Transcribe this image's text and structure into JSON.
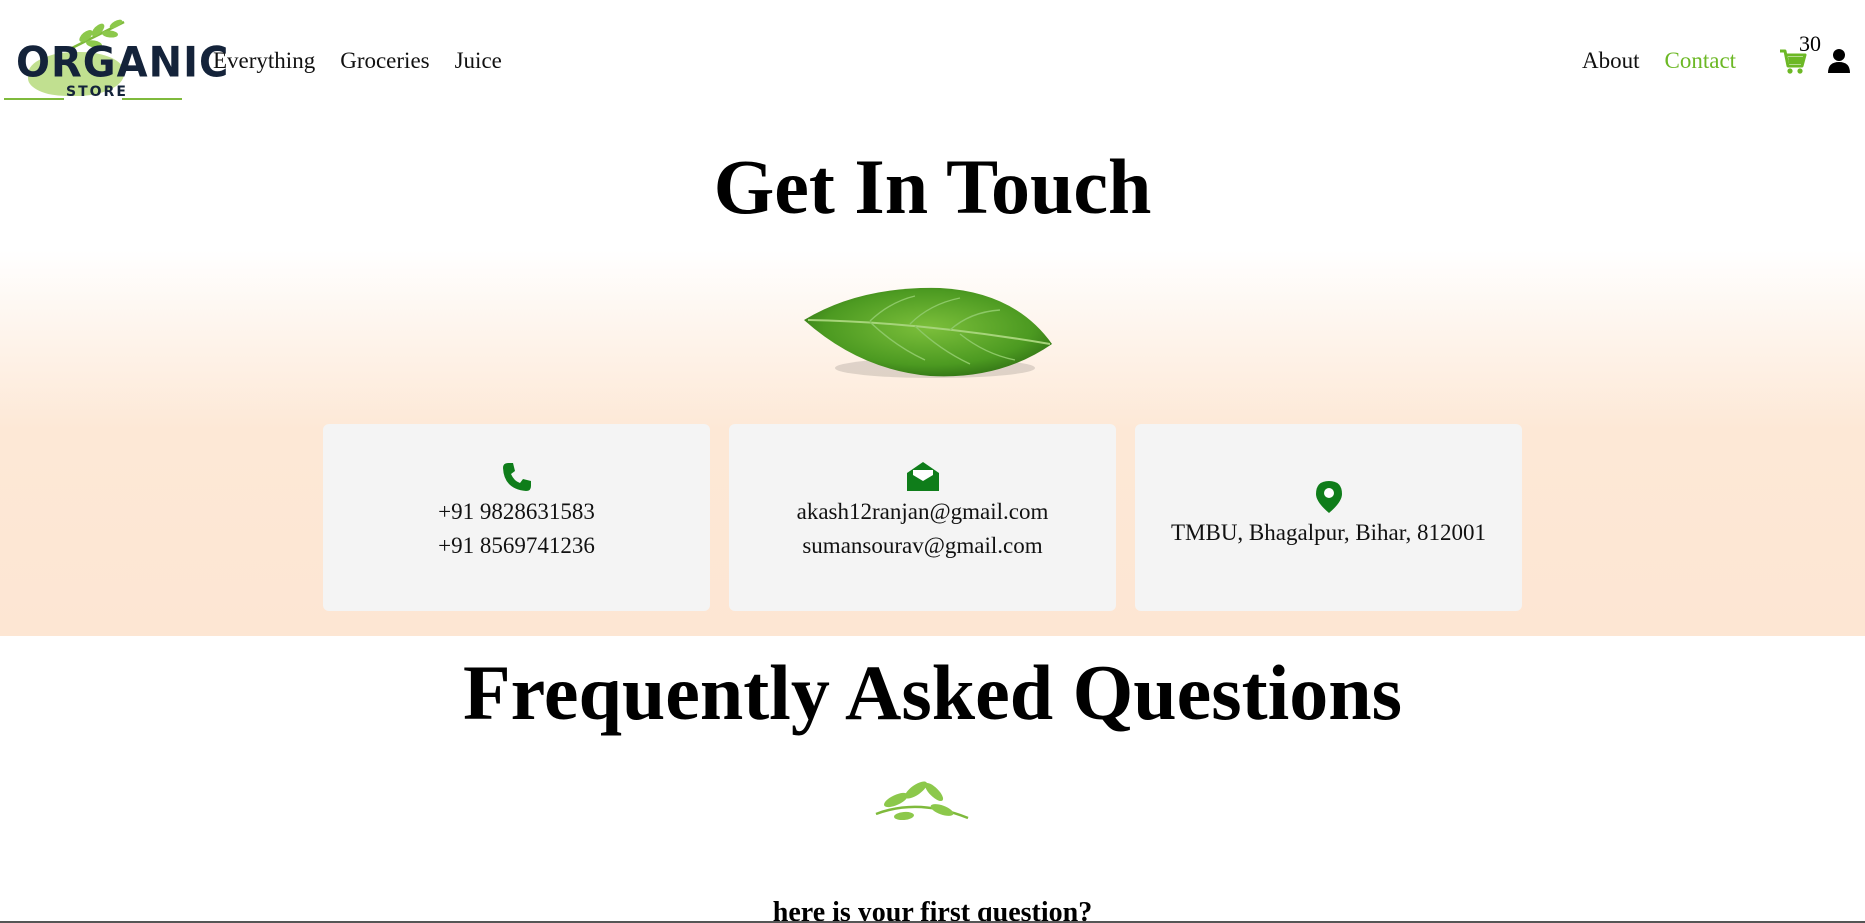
{
  "logo": {
    "word": "ORGANIC",
    "sub": "STORE"
  },
  "nav": {
    "left": [
      {
        "label": "Everything"
      },
      {
        "label": "Groceries"
      },
      {
        "label": "Juice"
      }
    ],
    "right": [
      {
        "label": "About"
      },
      {
        "label": "Contact"
      }
    ],
    "cart_count": "30"
  },
  "contact": {
    "title": "Get In Touch",
    "phone": {
      "line1": "+91 9828631583",
      "line2": "+91 8569741236"
    },
    "email": {
      "line1": "akash12ranjan@gmail.com",
      "line2": "sumansourav@gmail.com"
    },
    "address": {
      "line1": "TMBU, Bhagalpur, Bihar, 812001"
    }
  },
  "faq": {
    "title": "Frequently Asked Questions",
    "first_question": "here is your first question?"
  },
  "colors": {
    "accent_green": "#6cb825",
    "icon_green": "#0f7d1a",
    "card_bg": "#f4f4f4",
    "peach": "#fde6d3"
  }
}
